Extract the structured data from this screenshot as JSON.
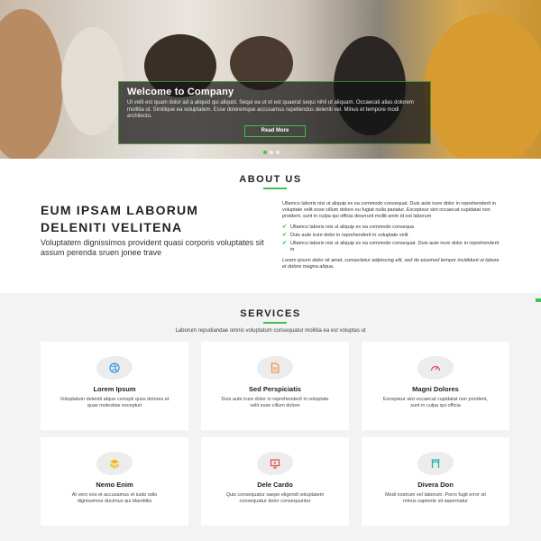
{
  "hero": {
    "title": "Welcome to Company",
    "text": "Ut velit est quam dolor ad a aliquid qui aliquid. Sequi ea ut et est quaerat sequi nihil ut aliquam. Occaecati alias dolorem mollitia ut. Similique ea voluptatem. Esse doloremque accusamus repellendus deleniti vel. Minus et tempore modi architecto.",
    "button_label": "Read More"
  },
  "about": {
    "heading": "ABOUT US",
    "big_title": "EUM IPSAM LABORUM DELENITI VELITENA",
    "lead": "Voluptatem dignissimos provident quasi corporis voluptates sit assum perenda sruen jonee trave",
    "paragraph": "Ullamco laboris nisi ut aliquip ex ea commodo consequat. Duis aute irure dolor in reprehenderit in voluptate velit esse cillum dolore eu fugiat nulla pariatur. Excepteur sint occaecat cupidatat non proident, sunt in culpa qui officia deserunt mollit anim id est laborum",
    "list": [
      "Ullamco laboris nisi ut aliquip ex ea commodo consequa",
      "Duis aute irure dolor in reprehenderit in voluptate velit",
      "Ullamco laboris nisi ut aliquip ex ea commodo consequat. Duis aute irure dolor in reprehenderit in"
    ],
    "italic": "Lorem ipsum dolor sit amet, consectetur adipiscing elit, sed do eiusmod tempor incididunt ut labore et dolore magna aliqua."
  },
  "services": {
    "heading": "SERVICES",
    "subtitle": "Laborum repudiandae omnis voluptatum consequatur mollitia ea est voluptas ut",
    "items": [
      {
        "title": "Lorem Ipsum",
        "text": "Voluptatum deleniti atque corrupti quos dolores et quas molestias excepturi",
        "icon": "dribbble-icon",
        "color": "#3b9ae1"
      },
      {
        "title": "Sed Perspiciatis",
        "text": "Duis aute irure dolor in reprehenderit in voluptate velit esse cillum dolore",
        "icon": "file-icon",
        "color": "#f58f3b"
      },
      {
        "title": "Magni Dolores",
        "text": "Excepteur sint occaecat cupidatat non proident, sunt in culpa qui officia",
        "icon": "tachometer-icon",
        "color": "#e5457a"
      },
      {
        "title": "Nemo Enim",
        "text": "At vero eos et accusamus et iusto odio dignissimos ducimus qui blanditiis",
        "icon": "layers-icon",
        "color": "#f2b705"
      },
      {
        "title": "Dele Cardo",
        "text": "Quis consequatur saepe eligendi voluptatem consequatur dolor consequuntur",
        "icon": "slideshow-icon",
        "color": "#e9443d"
      },
      {
        "title": "Divera Don",
        "text": "Modi nostrum vel laborum. Porro fugit error sit minus sapiente sit aspernatur",
        "icon": "arch-icon",
        "color": "#1fb5a8"
      }
    ]
  },
  "colors": {
    "accent": "#3fc34a"
  }
}
